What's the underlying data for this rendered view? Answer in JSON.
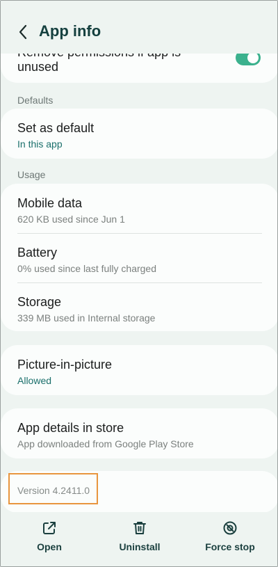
{
  "header": {
    "title": "App info",
    "back_icon": "chevron-left-icon"
  },
  "permissions": {
    "line1": "Remove permissions if app is",
    "line2": "unused",
    "toggle_on": true
  },
  "defaults": {
    "section_label": "Defaults",
    "set_as_default": {
      "title": "Set as default",
      "subtitle": "In this app"
    }
  },
  "usage": {
    "section_label": "Usage",
    "items": [
      {
        "title": "Mobile data",
        "subtitle": "620 KB used since Jun 1"
      },
      {
        "title": "Battery",
        "subtitle": "0% used since last fully charged"
      },
      {
        "title": "Storage",
        "subtitle": "339 MB used in Internal storage"
      }
    ]
  },
  "pip": {
    "title": "Picture-in-picture",
    "subtitle": "Allowed"
  },
  "store": {
    "title": "App details in store",
    "subtitle": "App downloaded from Google Play Store"
  },
  "version": "Version 4.2411.0",
  "actions": {
    "open": {
      "label": "Open",
      "icon": "open-external-icon"
    },
    "uninstall": {
      "label": "Uninstall",
      "icon": "trash-icon"
    },
    "force_stop": {
      "label": "Force stop",
      "icon": "stop-circle-icon"
    }
  },
  "colors": {
    "background": "#eef4f1",
    "card": "#fbfdfc",
    "accent": "#1a6f6b",
    "toggle": "#3bb18d",
    "highlight": "#e8953e"
  }
}
